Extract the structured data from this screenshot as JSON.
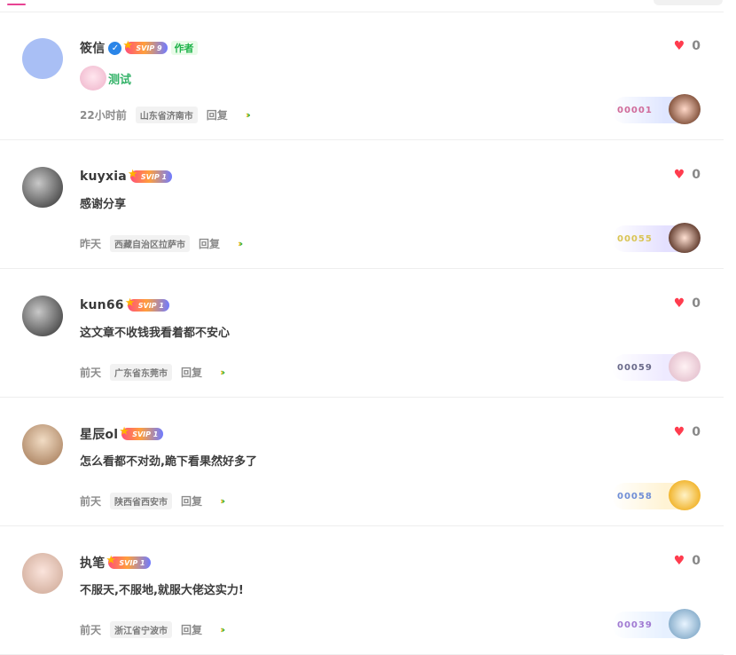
{
  "comments": [
    {
      "user": "筱信",
      "vip": "SVIP 9",
      "author_badge": "作者",
      "content": "测试",
      "time": "22小时前",
      "location": "山东省济南市",
      "reply": "回复",
      "likes": "0",
      "floor": "00001"
    },
    {
      "user": "kuyxia",
      "vip": "SVIP 1",
      "content": "感谢分享",
      "time": "昨天",
      "location": "西藏自治区拉萨市",
      "reply": "回复",
      "likes": "0",
      "floor": "00055"
    },
    {
      "user": "kun66",
      "vip": "SVIP 1",
      "content": "这文章不收钱我看着都不安心",
      "time": "前天",
      "location": "广东省东莞市",
      "reply": "回复",
      "likes": "0",
      "floor": "00059"
    },
    {
      "user": "星辰ol",
      "vip": "SVIP 1",
      "content": "怎么看都不对劲,跪下看果然好多了",
      "time": "前天",
      "location": "陕西省西安市",
      "reply": "回复",
      "likes": "0",
      "floor": "00058"
    },
    {
      "user": "执笔",
      "vip": "SVIP 1",
      "content": "不服天,不服地,就服大佬这实力!",
      "time": "前天",
      "location": "浙江省宁波市",
      "reply": "回复",
      "likes": "0",
      "floor": "00039"
    }
  ]
}
